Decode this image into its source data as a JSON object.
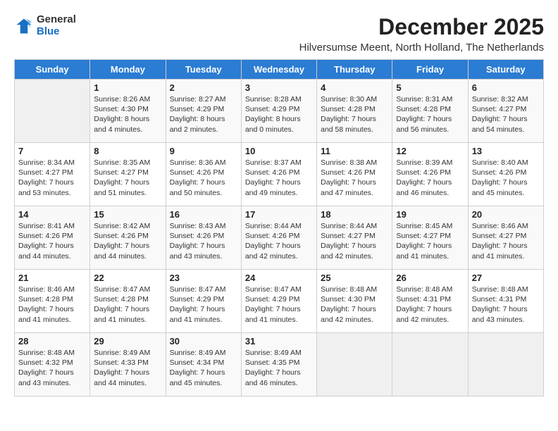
{
  "logo": {
    "general": "General",
    "blue": "Blue"
  },
  "header": {
    "month_year": "December 2025",
    "location": "Hilversumse Meent, North Holland, The Netherlands"
  },
  "days_of_week": [
    "Sunday",
    "Monday",
    "Tuesday",
    "Wednesday",
    "Thursday",
    "Friday",
    "Saturday"
  ],
  "weeks": [
    [
      {
        "day": "",
        "info": ""
      },
      {
        "day": "1",
        "info": "Sunrise: 8:26 AM\nSunset: 4:30 PM\nDaylight: 8 hours\nand 4 minutes."
      },
      {
        "day": "2",
        "info": "Sunrise: 8:27 AM\nSunset: 4:29 PM\nDaylight: 8 hours\nand 2 minutes."
      },
      {
        "day": "3",
        "info": "Sunrise: 8:28 AM\nSunset: 4:29 PM\nDaylight: 8 hours\nand 0 minutes."
      },
      {
        "day": "4",
        "info": "Sunrise: 8:30 AM\nSunset: 4:28 PM\nDaylight: 7 hours\nand 58 minutes."
      },
      {
        "day": "5",
        "info": "Sunrise: 8:31 AM\nSunset: 4:28 PM\nDaylight: 7 hours\nand 56 minutes."
      },
      {
        "day": "6",
        "info": "Sunrise: 8:32 AM\nSunset: 4:27 PM\nDaylight: 7 hours\nand 54 minutes."
      }
    ],
    [
      {
        "day": "7",
        "info": "Sunrise: 8:34 AM\nSunset: 4:27 PM\nDaylight: 7 hours\nand 53 minutes."
      },
      {
        "day": "8",
        "info": "Sunrise: 8:35 AM\nSunset: 4:27 PM\nDaylight: 7 hours\nand 51 minutes."
      },
      {
        "day": "9",
        "info": "Sunrise: 8:36 AM\nSunset: 4:26 PM\nDaylight: 7 hours\nand 50 minutes."
      },
      {
        "day": "10",
        "info": "Sunrise: 8:37 AM\nSunset: 4:26 PM\nDaylight: 7 hours\nand 49 minutes."
      },
      {
        "day": "11",
        "info": "Sunrise: 8:38 AM\nSunset: 4:26 PM\nDaylight: 7 hours\nand 47 minutes."
      },
      {
        "day": "12",
        "info": "Sunrise: 8:39 AM\nSunset: 4:26 PM\nDaylight: 7 hours\nand 46 minutes."
      },
      {
        "day": "13",
        "info": "Sunrise: 8:40 AM\nSunset: 4:26 PM\nDaylight: 7 hours\nand 45 minutes."
      }
    ],
    [
      {
        "day": "14",
        "info": "Sunrise: 8:41 AM\nSunset: 4:26 PM\nDaylight: 7 hours\nand 44 minutes."
      },
      {
        "day": "15",
        "info": "Sunrise: 8:42 AM\nSunset: 4:26 PM\nDaylight: 7 hours\nand 44 minutes."
      },
      {
        "day": "16",
        "info": "Sunrise: 8:43 AM\nSunset: 4:26 PM\nDaylight: 7 hours\nand 43 minutes."
      },
      {
        "day": "17",
        "info": "Sunrise: 8:44 AM\nSunset: 4:26 PM\nDaylight: 7 hours\nand 42 minutes."
      },
      {
        "day": "18",
        "info": "Sunrise: 8:44 AM\nSunset: 4:27 PM\nDaylight: 7 hours\nand 42 minutes."
      },
      {
        "day": "19",
        "info": "Sunrise: 8:45 AM\nSunset: 4:27 PM\nDaylight: 7 hours\nand 41 minutes."
      },
      {
        "day": "20",
        "info": "Sunrise: 8:46 AM\nSunset: 4:27 PM\nDaylight: 7 hours\nand 41 minutes."
      }
    ],
    [
      {
        "day": "21",
        "info": "Sunrise: 8:46 AM\nSunset: 4:28 PM\nDaylight: 7 hours\nand 41 minutes."
      },
      {
        "day": "22",
        "info": "Sunrise: 8:47 AM\nSunset: 4:28 PM\nDaylight: 7 hours\nand 41 minutes."
      },
      {
        "day": "23",
        "info": "Sunrise: 8:47 AM\nSunset: 4:29 PM\nDaylight: 7 hours\nand 41 minutes."
      },
      {
        "day": "24",
        "info": "Sunrise: 8:47 AM\nSunset: 4:29 PM\nDaylight: 7 hours\nand 41 minutes."
      },
      {
        "day": "25",
        "info": "Sunrise: 8:48 AM\nSunset: 4:30 PM\nDaylight: 7 hours\nand 42 minutes."
      },
      {
        "day": "26",
        "info": "Sunrise: 8:48 AM\nSunset: 4:31 PM\nDaylight: 7 hours\nand 42 minutes."
      },
      {
        "day": "27",
        "info": "Sunrise: 8:48 AM\nSunset: 4:31 PM\nDaylight: 7 hours\nand 43 minutes."
      }
    ],
    [
      {
        "day": "28",
        "info": "Sunrise: 8:48 AM\nSunset: 4:32 PM\nDaylight: 7 hours\nand 43 minutes."
      },
      {
        "day": "29",
        "info": "Sunrise: 8:49 AM\nSunset: 4:33 PM\nDaylight: 7 hours\nand 44 minutes."
      },
      {
        "day": "30",
        "info": "Sunrise: 8:49 AM\nSunset: 4:34 PM\nDaylight: 7 hours\nand 45 minutes."
      },
      {
        "day": "31",
        "info": "Sunrise: 8:49 AM\nSunset: 4:35 PM\nDaylight: 7 hours\nand 46 minutes."
      },
      {
        "day": "",
        "info": ""
      },
      {
        "day": "",
        "info": ""
      },
      {
        "day": "",
        "info": ""
      }
    ]
  ]
}
